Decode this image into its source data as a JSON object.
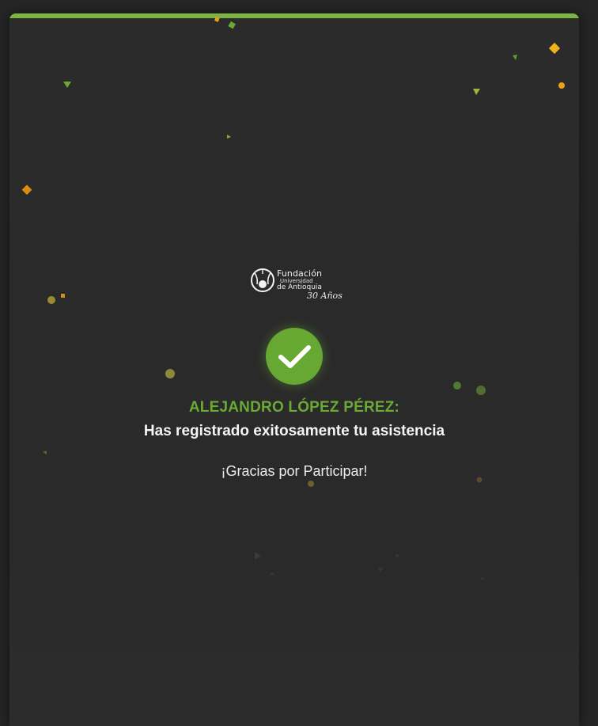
{
  "logo": {
    "line1": "Fundación",
    "line2": "Universidad",
    "line3": "de Antioquia",
    "anniversary": "30 Años"
  },
  "confirmation": {
    "name": "ALEJANDRO LÓPEZ PÉREZ:",
    "message": "Has registrado exitosamente tu asistencia",
    "thanks": "¡Gracias por Participar!"
  },
  "colors": {
    "accent": "#7cb342",
    "success": "#66a832",
    "background": "#2a2a2a",
    "confetti_orange": "#e8a317",
    "confetti_green": "#6aa832"
  },
  "icons": {
    "status": "checkmark-icon"
  }
}
